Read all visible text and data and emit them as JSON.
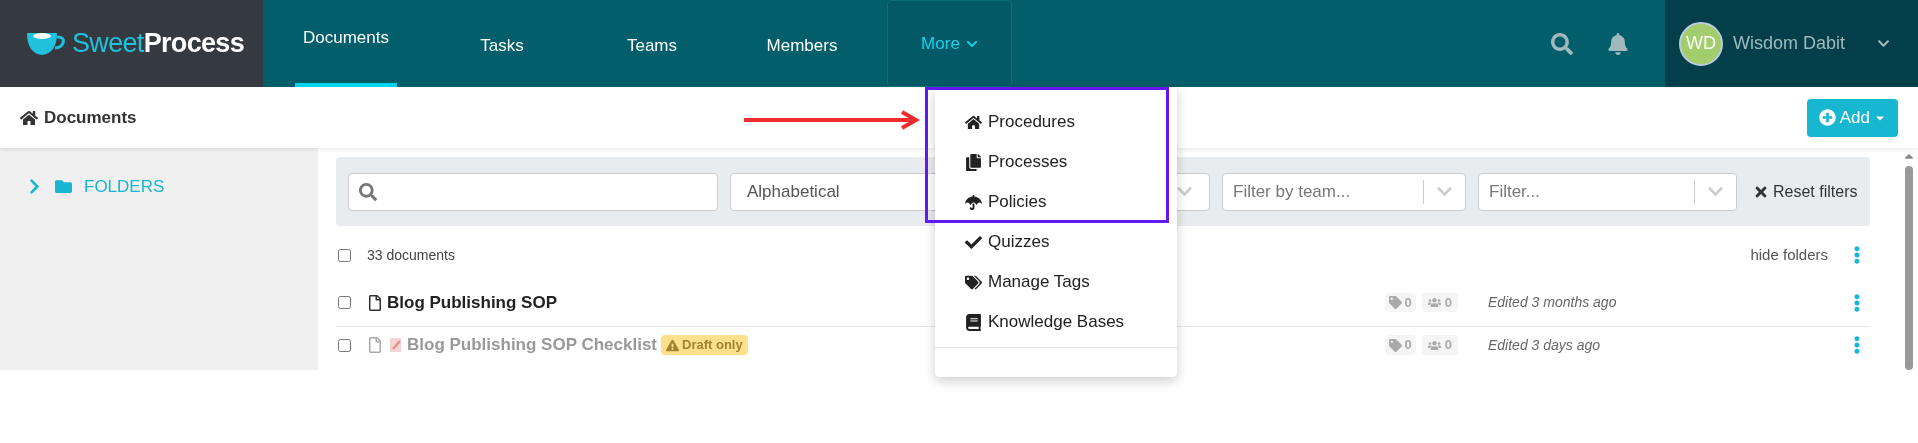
{
  "logo": {
    "part_1": "Sweet",
    "part_2": "Process"
  },
  "nav": [
    {
      "label": "Documents",
      "selected": true,
      "kind": "link"
    },
    {
      "label": "Tasks",
      "selected": false,
      "kind": "link"
    },
    {
      "label": "Teams",
      "selected": false,
      "kind": "link"
    },
    {
      "label": "Members",
      "selected": false,
      "kind": "link"
    },
    {
      "label": "More",
      "selected": false,
      "kind": "menu",
      "expanded": true
    }
  ],
  "user": {
    "initials": "WD",
    "name": "Wisdom Dabit"
  },
  "breadcrumb": "Documents",
  "add_button": "Add",
  "sidebar": {
    "folders": {
      "label": "FOLDERS",
      "expanded": false
    }
  },
  "filters": {
    "sort": "Alphabetical",
    "team": {
      "placeholder": "Filter by team..."
    },
    "other": {
      "placeholder": "Filter..."
    },
    "reset": "Reset filters"
  },
  "list": {
    "count": "33 documents",
    "all_checked": false,
    "hide_folders": "hide folders",
    "rows": [
      {
        "title": "Blog Publishing SOP",
        "draft": false,
        "tags": "0",
        "members": "0",
        "edited": "Edited 3 months ago",
        "checked": false
      },
      {
        "title": "Blog Publishing SOP Checklist",
        "draft": true,
        "badge": "Draft only",
        "tags": "0",
        "members": "0",
        "edited": "Edited 3 days ago",
        "checked": false
      }
    ]
  },
  "more_menu": [
    {
      "label": "Procedures",
      "kind": "home"
    },
    {
      "label": "Processes",
      "kind": "copy"
    },
    {
      "label": "Policies",
      "kind": "umbrella"
    },
    {
      "label": "Quizzes",
      "kind": "check"
    },
    {
      "label": "Manage Tags",
      "kind": "tags"
    },
    {
      "label": "Knowledge Bases",
      "kind": "book"
    }
  ]
}
